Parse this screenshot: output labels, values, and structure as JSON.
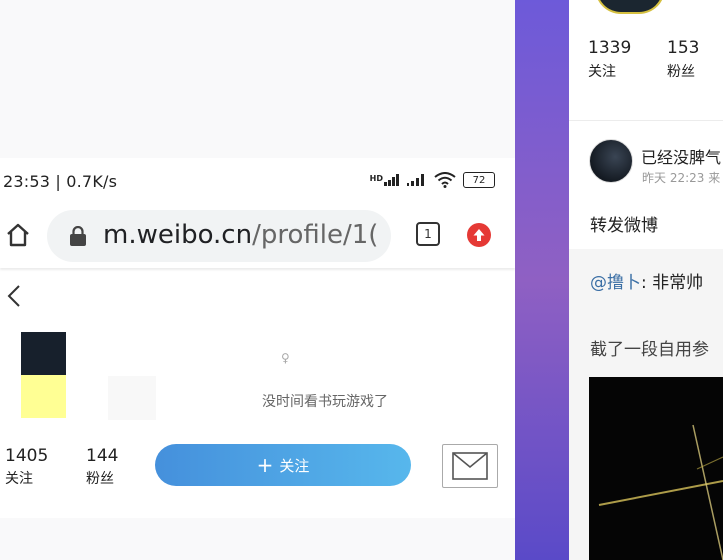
{
  "status_bar": {
    "time": "23:53 | 0.7K/s",
    "hd_label": "HD",
    "battery": "72"
  },
  "browser": {
    "url_host": "m.weibo.cn",
    "url_path": "/profile/1(",
    "tab_count": "1"
  },
  "profile": {
    "gender_mark": "♀",
    "bio": "没时间看书玩游戏了",
    "following_count": "1405",
    "following_label": "关注",
    "followers_count": "144",
    "followers_label": "粉丝",
    "follow_button_icon": "+",
    "follow_button_label": "关注"
  },
  "right_panel": {
    "following_count": "1339",
    "following_label": "关注",
    "followers_count": "153",
    "followers_label": "粉丝",
    "post": {
      "username": "已经没脾气",
      "time": "昨天 22:23 来",
      "repost_label": "转发微博",
      "mention": "@撸卜",
      "mention_text": ": 非常帅",
      "description": "截了一段自用参"
    }
  },
  "colors": {
    "follow_button": "#4a9de3",
    "accent_link": "#3b6fa5",
    "update_badge": "#e53935"
  }
}
